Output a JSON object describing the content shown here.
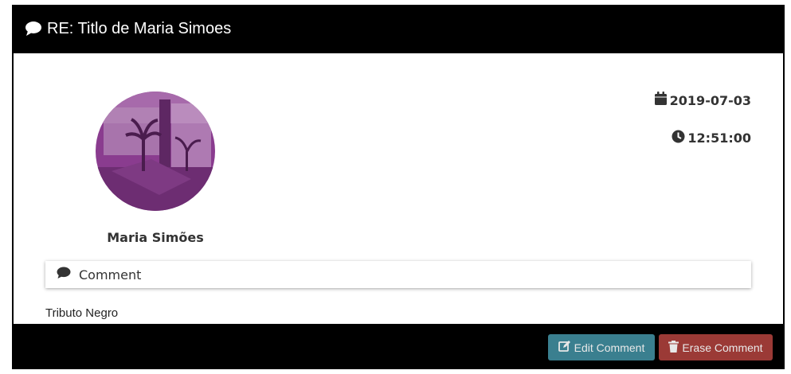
{
  "header": {
    "title": "RE: Titlo de Maria Simoes",
    "icon": "comment-icon"
  },
  "post": {
    "author": "Maria Simões",
    "date": "2019-07-03",
    "time": "12:51:00",
    "avatar_tint": "#8a3c8f"
  },
  "comment_section": {
    "label": "Comment",
    "text": "Tributo Negro"
  },
  "footer": {
    "edit_label": "Edit Comment",
    "erase_label": "Erase Comment"
  },
  "colors": {
    "edit": "#3a7f8f",
    "erase": "#9b3a36",
    "frame": "#000000"
  }
}
